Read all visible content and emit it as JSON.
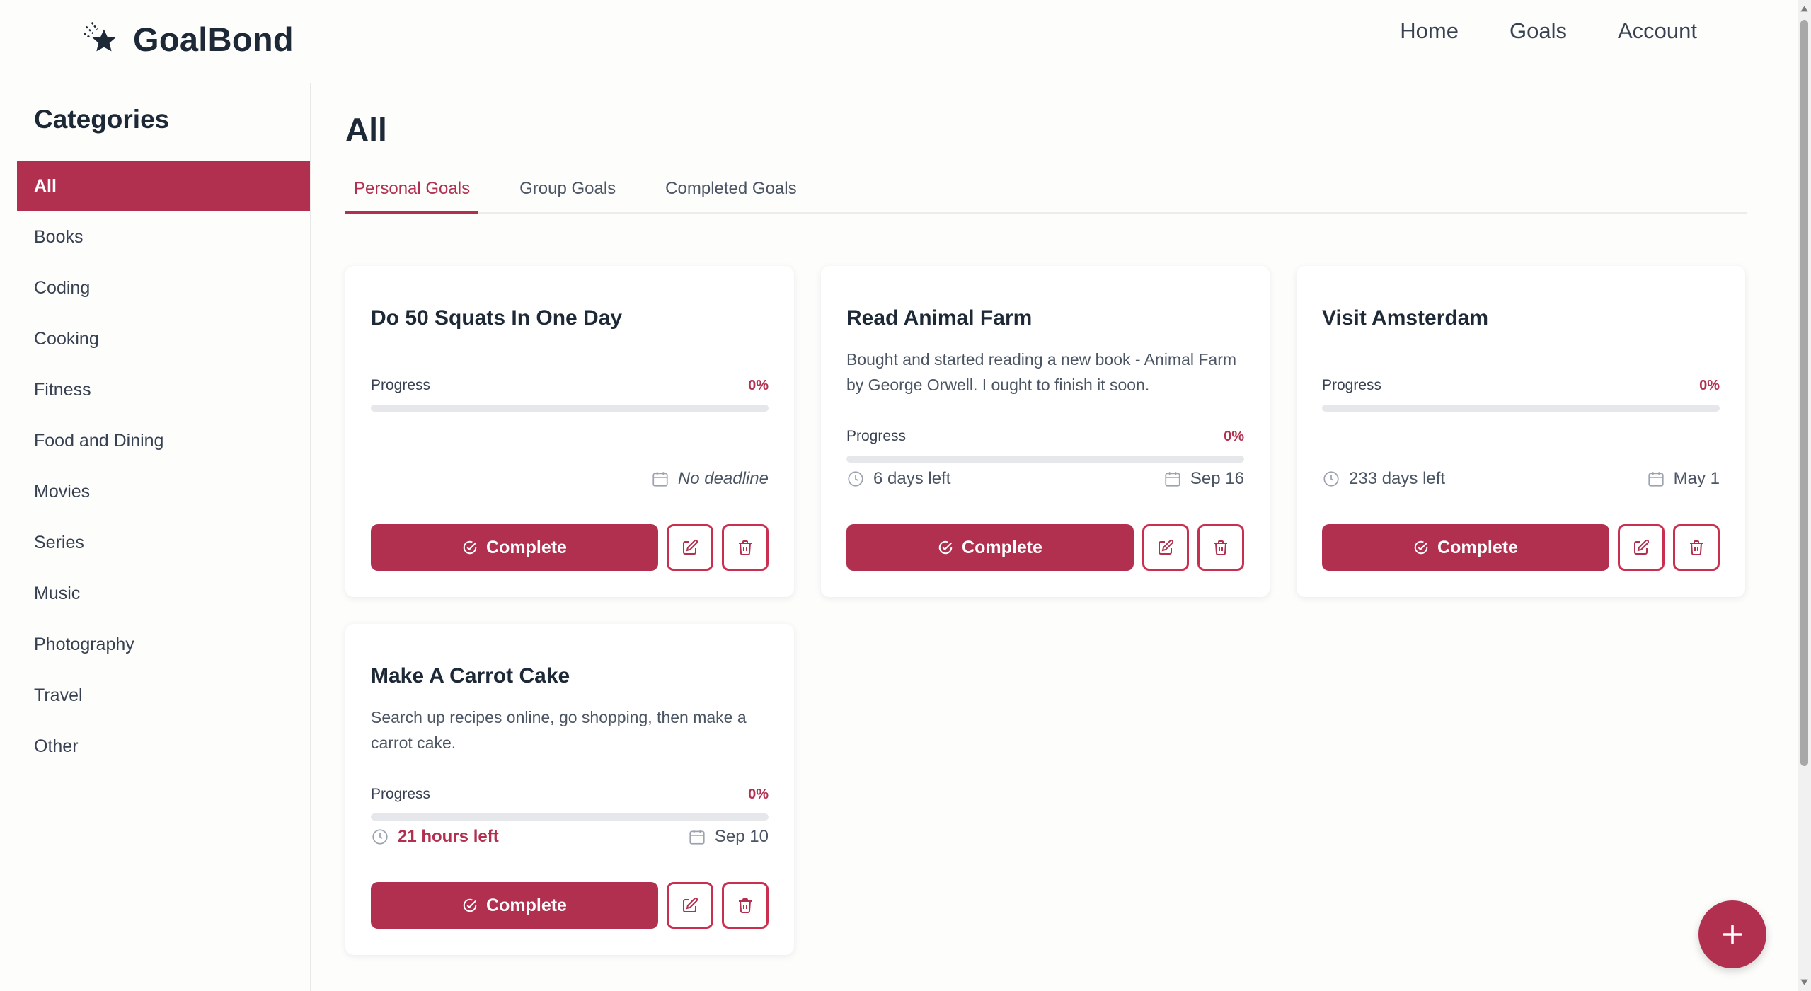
{
  "brand": {
    "name": "GoalBond"
  },
  "nav": {
    "items": [
      "Home",
      "Goals",
      "Account"
    ]
  },
  "sidebar": {
    "title": "Categories",
    "selected": "All",
    "items": [
      "All",
      "Books",
      "Coding",
      "Cooking",
      "Fitness",
      "Food and Dining",
      "Movies",
      "Series",
      "Music",
      "Photography",
      "Travel",
      "Other"
    ]
  },
  "main": {
    "title": "All",
    "active_tab": "Personal Goals",
    "tabs": [
      "Personal Goals",
      "Group Goals",
      "Completed Goals"
    ]
  },
  "goals": [
    {
      "title": "Do 50 Squats In One Day",
      "description": "",
      "progress_label": "Progress",
      "progress": "0%",
      "progress_fraction": 0,
      "time_left": "",
      "deadline": "No deadline",
      "complete_label": "Complete"
    },
    {
      "title": "Read Animal Farm",
      "description": "Bought and started reading a new book - Animal Farm by George Orwell. I ought to finish it soon.",
      "progress_label": "Progress",
      "progress": "0%",
      "progress_fraction": 0,
      "time_left": "6 days left",
      "deadline": "Sep 16",
      "complete_label": "Complete"
    },
    {
      "title": "Visit Amsterdam",
      "description": "",
      "progress_label": "Progress",
      "progress": "0%",
      "progress_fraction": 0,
      "time_left": "233 days left",
      "deadline": "May 1",
      "complete_label": "Complete"
    },
    {
      "title": "Make A Carrot Cake",
      "description": "Search up recipes online, go shopping, then make a carrot cake.",
      "progress_label": "Progress",
      "progress": "0%",
      "progress_fraction": 0,
      "time_left": "21 hours left",
      "time_left_urgent": true,
      "deadline": "Sep 10",
      "complete_label": "Complete"
    }
  ],
  "icons": {
    "brand": "star-logo-icon",
    "complete": "check-circle-icon",
    "edit": "edit-icon",
    "delete": "trash-icon",
    "time_left": "clock-icon",
    "deadline": "calendar-icon",
    "add": "plus-icon"
  },
  "colors": {
    "accent": "#b2304f",
    "heading": "#1e2938",
    "body_text": "#4b5563",
    "track": "#e5e7eb"
  }
}
